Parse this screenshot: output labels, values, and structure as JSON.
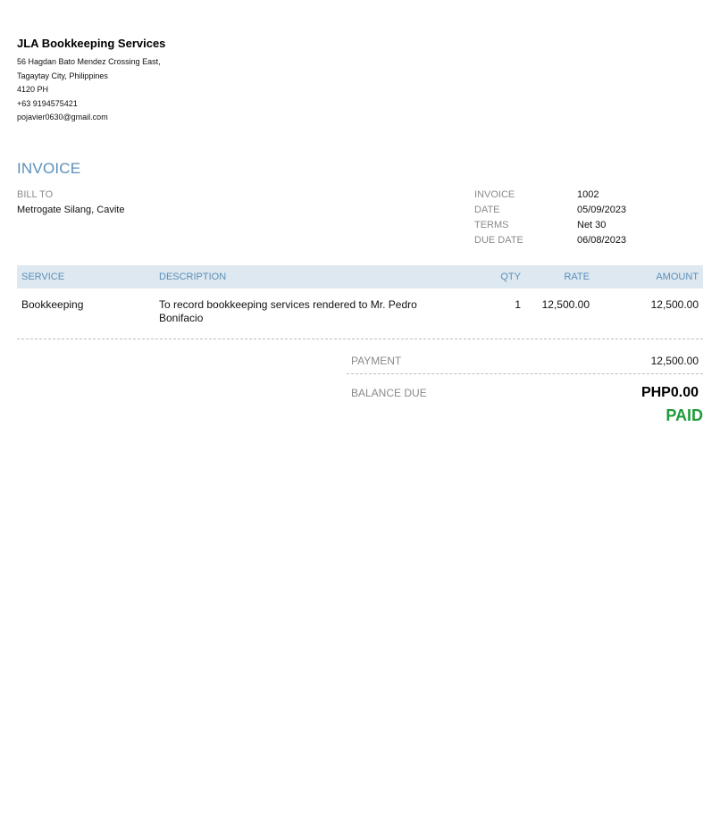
{
  "company": {
    "name": "JLA Bookkeeping Services",
    "address_lines": [
      "56 Hagdan Bato Mendez Crossing East,",
      "Tagaytay City, Philippines",
      "4120 PH",
      "+63 9194575421",
      "pojavier0630@gmail.com"
    ]
  },
  "invoice": {
    "title": "INVOICE",
    "bill_to_label": "BILL TO",
    "bill_to_value": "Metrogate Silang, Cavite",
    "meta": [
      {
        "label": "INVOICE",
        "value": "1002"
      },
      {
        "label": "DATE",
        "value": "05/09/2023"
      },
      {
        "label": "TERMS",
        "value": "Net 30"
      },
      {
        "label": "DUE DATE",
        "value": "06/08/2023"
      }
    ]
  },
  "items_table": {
    "headers": {
      "service": "SERVICE",
      "description": "DESCRIPTION",
      "qty": "QTY",
      "rate": "RATE",
      "amount": "AMOUNT"
    },
    "rows": [
      {
        "service": "Bookkeeping",
        "description": "To record bookkeeping services rendered to Mr. Pedro Bonifacio",
        "qty": "1",
        "rate": "12,500.00",
        "amount": "12,500.00"
      }
    ]
  },
  "totals": {
    "payment_label": "PAYMENT",
    "payment_value": "12,500.00",
    "balance_label": "BALANCE DUE",
    "balance_value": "PHP0.00",
    "status": "PAID"
  },
  "colors": {
    "accent": "#5b8fb9",
    "header_bg": "#dde8f0",
    "paid": "#1f9b3a",
    "muted_label": "#8a8a8a"
  }
}
